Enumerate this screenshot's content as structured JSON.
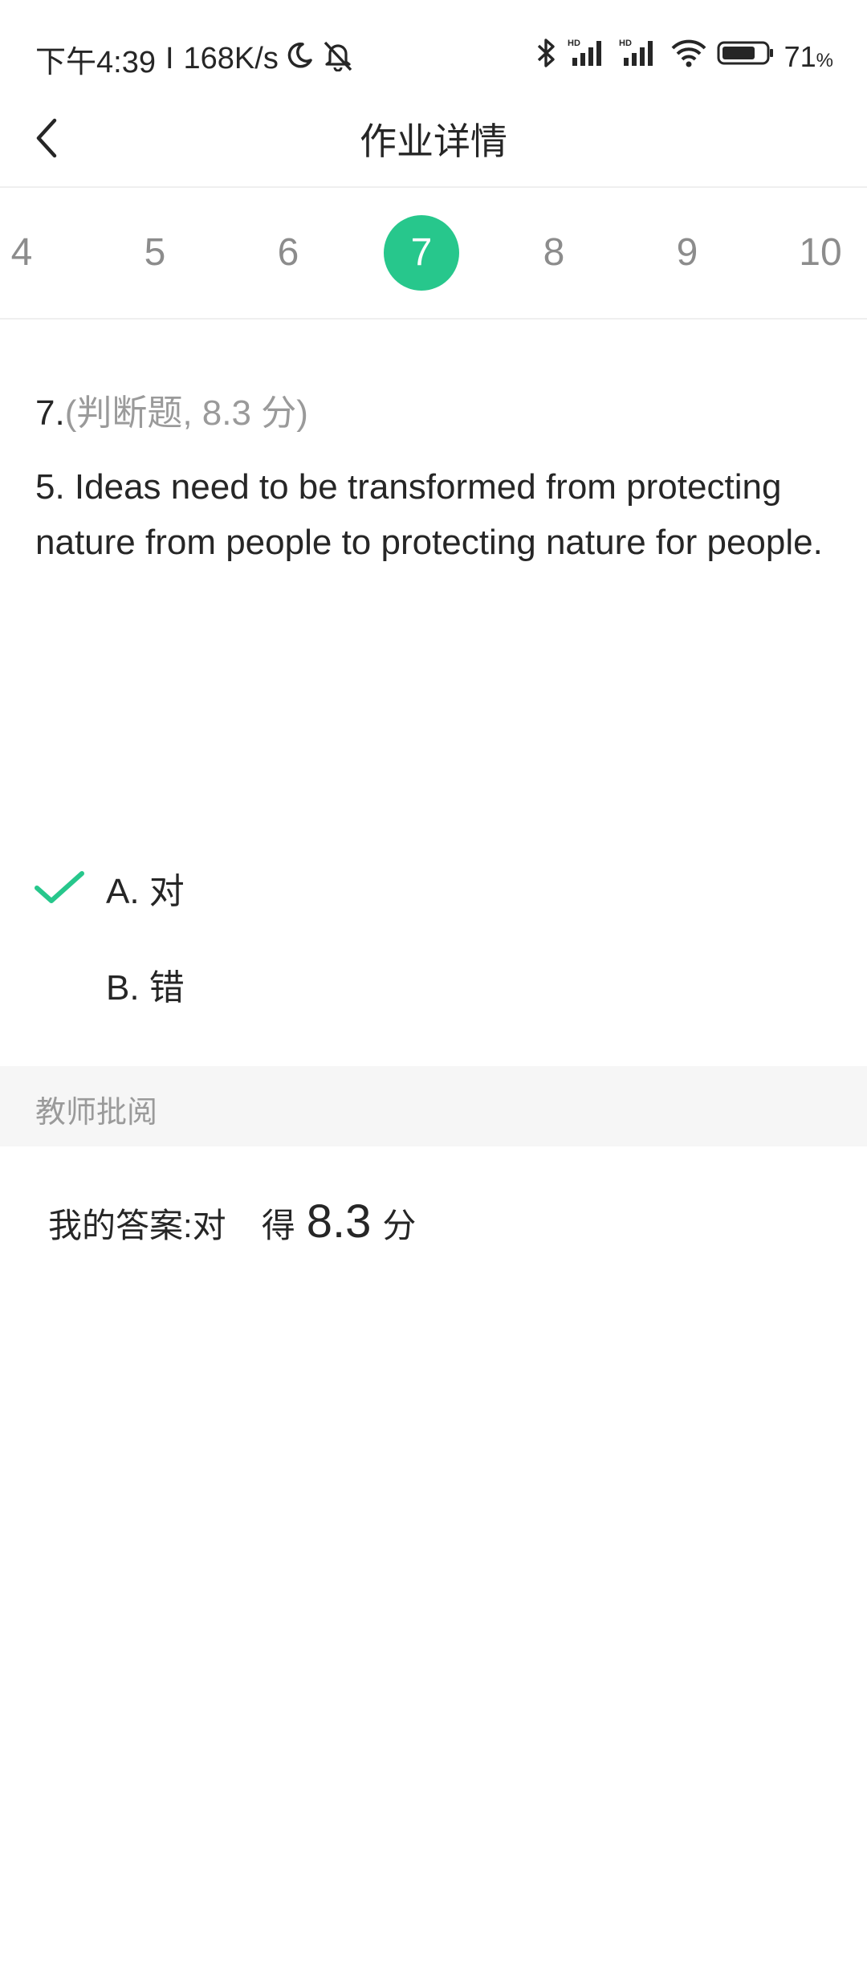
{
  "status_bar": {
    "time": "下午4:39",
    "separator": "I",
    "speed": "168K/s",
    "battery": "71",
    "battery_unit": "%",
    "icons": [
      "moon-icon",
      "bell-muted-icon",
      "bluetooth-icon",
      "signal-hd-icon",
      "signal-hd-icon",
      "wifi-icon",
      "battery-icon"
    ]
  },
  "header": {
    "title": "作业详情"
  },
  "tabs": {
    "items": [
      "4",
      "5",
      "6",
      "7",
      "8",
      "9",
      "10"
    ],
    "active": "7"
  },
  "question": {
    "number": "7.",
    "meta": "(判断题,  8.3 分)",
    "text": "5. Ideas need to be transformed from protecting nature from people to protecting nature for people.",
    "options": [
      {
        "label": "A. 对",
        "selected": true
      },
      {
        "label": "B. 错",
        "selected": false
      }
    ]
  },
  "review": {
    "title": "教师批阅",
    "answer_label": "我的答案:",
    "answer_value": "对",
    "score_prefix": "得",
    "score": "8.3",
    "score_unit": "分"
  },
  "colors": {
    "accent": "#27c78c",
    "text": "#262626",
    "muted": "#9a9a9a",
    "divider": "#efefef",
    "section_bg": "#f6f6f6"
  }
}
